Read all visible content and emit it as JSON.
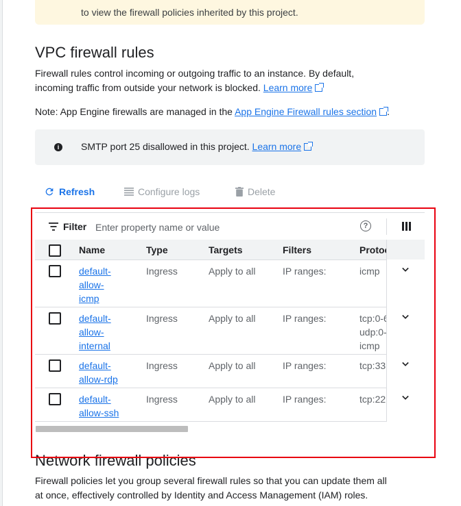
{
  "banner": {
    "text": "to view the firewall policies inherited by this project."
  },
  "section_vpc": {
    "title": "VPC firewall rules",
    "description": "Firewall rules control incoming or outgoing traffic to an instance. By default, incoming traffic from outside your network is blocked.",
    "learn_more": "Learn more",
    "note_prefix": "Note: App Engine firewalls are managed in the",
    "note_link": "App Engine Firewall rules section",
    "note_suffix": "."
  },
  "notice": {
    "icon": "info-icon",
    "text": "SMTP port 25 disallowed in this project.",
    "learn_more": "Learn more"
  },
  "toolbar": {
    "refresh_label": "Refresh",
    "configure_logs_label": "Configure logs",
    "delete_label": "Delete"
  },
  "filter": {
    "label": "Filter",
    "placeholder": "Enter property name or value"
  },
  "table": {
    "columns": [
      "Name",
      "Type",
      "Targets",
      "Filters",
      "Protoc"
    ],
    "rows": [
      {
        "name": [
          "default-",
          "allow-",
          "icmp"
        ],
        "type": "Ingress",
        "targets": "Apply to all",
        "filters": "IP ranges:",
        "protocols": [
          "icmp"
        ]
      },
      {
        "name": [
          "default-",
          "allow-",
          "internal"
        ],
        "type": "Ingress",
        "targets": "Apply to all",
        "filters": "IP ranges:",
        "protocols": [
          "tcp:0-6",
          "udp:0-",
          "icmp"
        ]
      },
      {
        "name": [
          "default-",
          "allow-rdp"
        ],
        "type": "Ingress",
        "targets": "Apply to all",
        "filters": "IP ranges:",
        "protocols": [
          "tcp:33"
        ]
      },
      {
        "name": [
          "default-",
          "allow-ssh"
        ],
        "type": "Ingress",
        "targets": "Apply to all",
        "filters": "IP ranges:",
        "protocols": [
          "tcp:22"
        ]
      }
    ]
  },
  "section_network": {
    "title": "Network firewall policies",
    "description": "Firewall policies let you group several firewall rules so that you can update them all at once, effectively controlled by Identity and Access Management (IAM) roles."
  },
  "colors": {
    "link": "#1a73e8",
    "highlight": "#e8000f",
    "notice_bg": "#f1f3f4",
    "banner_bg": "#fef7e0"
  }
}
